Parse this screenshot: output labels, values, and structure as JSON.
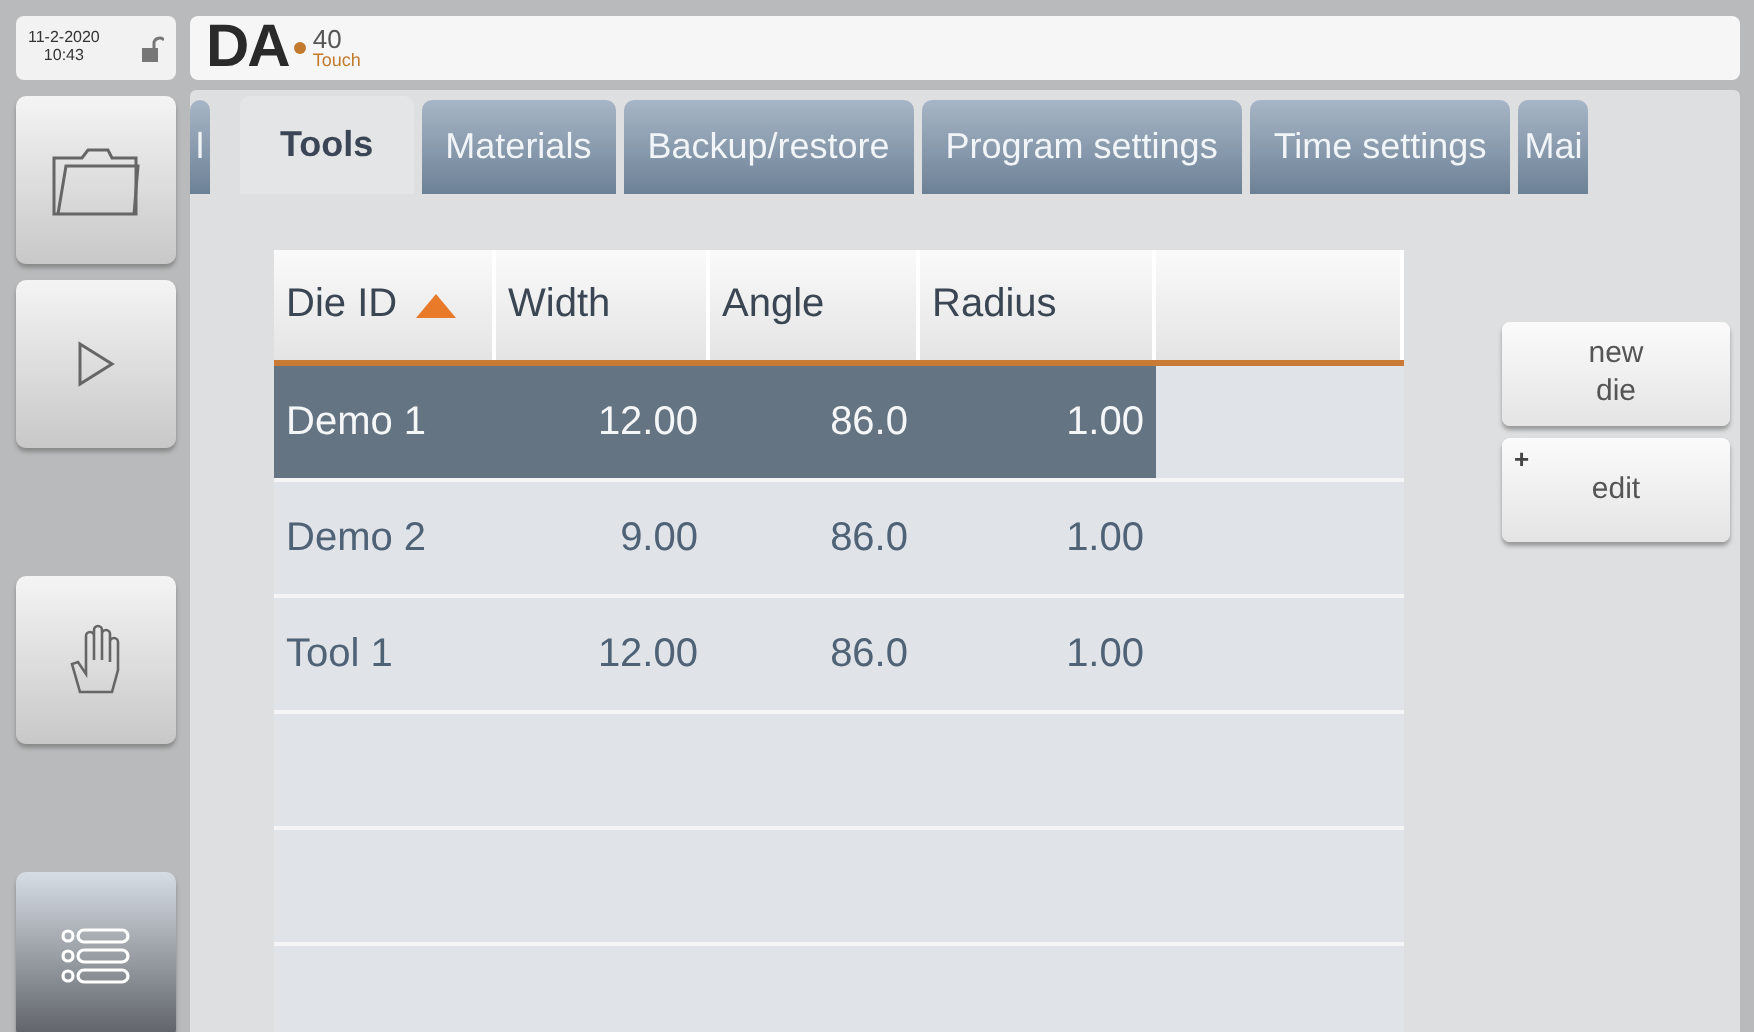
{
  "clock": {
    "date": "11-2-2020",
    "time": "10:43",
    "locked": false
  },
  "logo": {
    "brand": "DA",
    "model": "40",
    "edition": "Touch"
  },
  "sidebar": [
    {
      "kind": "folder",
      "selected": false
    },
    {
      "kind": "play",
      "selected": false
    },
    {
      "kind": "hand",
      "selected": false
    },
    {
      "kind": "menu",
      "selected": true
    }
  ],
  "tabs": [
    {
      "label": "l",
      "selected": false
    },
    {
      "label": "Tools",
      "selected": true
    },
    {
      "label": "Materials",
      "selected": false
    },
    {
      "label": "Backup/restore",
      "selected": false
    },
    {
      "label": "Program settings",
      "selected": false
    },
    {
      "label": "Time settings",
      "selected": false
    },
    {
      "label": "Mai",
      "selected": false
    }
  ],
  "table": {
    "columns": [
      {
        "label": "Die ID",
        "sorted": true
      },
      {
        "label": "Width",
        "sorted": false
      },
      {
        "label": "Angle",
        "sorted": false
      },
      {
        "label": "Radius",
        "sorted": false
      }
    ],
    "rows": [
      {
        "cells": [
          "Demo 1",
          "12.00",
          "86.0",
          "1.00"
        ],
        "selected": true
      },
      {
        "cells": [
          "Demo 2",
          "9.00",
          "86.0",
          "1.00"
        ],
        "selected": false
      },
      {
        "cells": [
          "Tool 1",
          "12.00",
          "86.0",
          "1.00"
        ],
        "selected": false
      }
    ]
  },
  "buttons": [
    {
      "label": "new die"
    },
    {
      "label": "edit",
      "corner_mark": "+"
    }
  ]
}
